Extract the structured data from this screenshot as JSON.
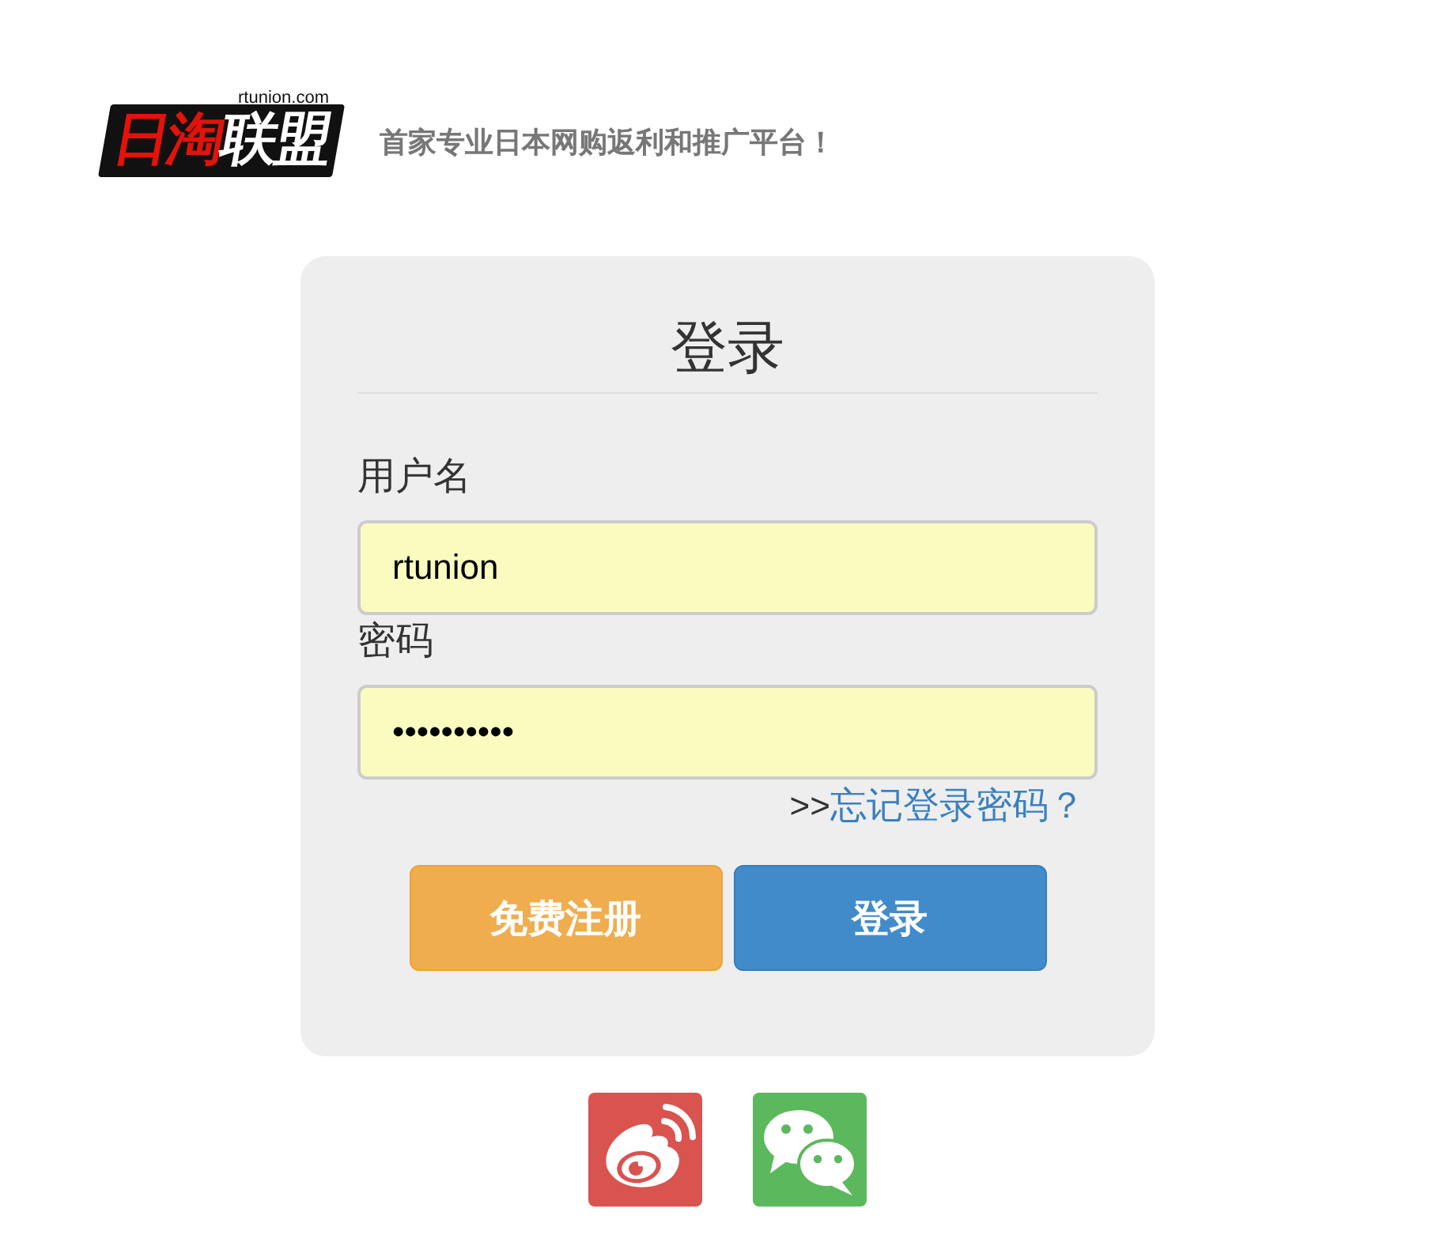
{
  "header": {
    "logo": {
      "domain": "rtunion.com",
      "parts": [
        {
          "text": "日淘",
          "color": "#e3120b"
        },
        {
          "text": "联盟",
          "color": "#ffffff"
        }
      ]
    },
    "slogan": "首家专业日本网购返利和推广平台！"
  },
  "login_form": {
    "title": "登录",
    "fields": [
      {
        "label": "用户名",
        "value": "rtunion"
      },
      {
        "label": "密码",
        "value": "••••••••••"
      }
    ],
    "forgot": {
      "prefix": ">>",
      "link": "忘记登录密码？"
    },
    "buttons": [
      {
        "label": "免费注册",
        "kind": "register"
      },
      {
        "label": "登录",
        "kind": "submit"
      }
    ]
  },
  "social_logins": [
    {
      "kind": "weibo"
    },
    {
      "kind": "wechat"
    }
  ]
}
